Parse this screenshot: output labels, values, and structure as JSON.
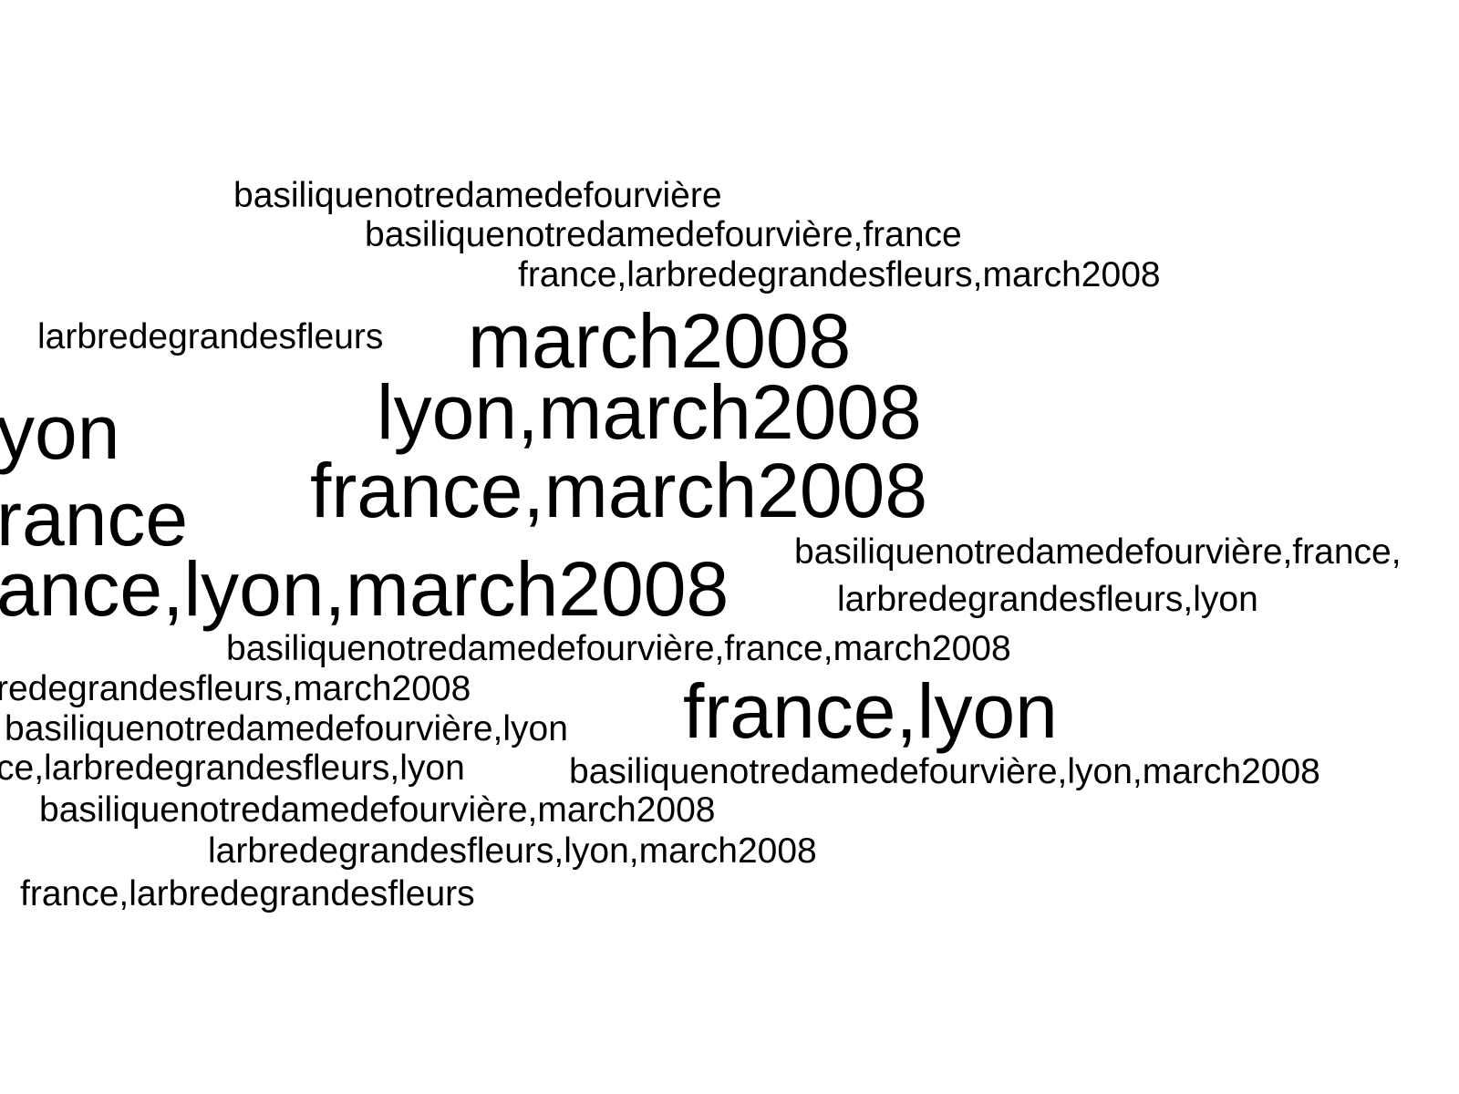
{
  "word_cloud": {
    "text_color": "#000000",
    "background_color": "#ffffff",
    "words": [
      {
        "text": "basiliquenotredamedefourvière",
        "size": "small"
      },
      {
        "text": "basiliquenotredamedefourvière,france",
        "size": "small"
      },
      {
        "text": "france,larbredegrandesfleurs,march2008",
        "size": "small"
      },
      {
        "text": "larbredegrandesfleurs",
        "size": "small"
      },
      {
        "text": "march2008",
        "size": "large"
      },
      {
        "text": "lyon,march2008",
        "size": "large"
      },
      {
        "text": "yon",
        "size": "large"
      },
      {
        "text": "france,march2008",
        "size": "large"
      },
      {
        "text": "rance",
        "size": "large"
      },
      {
        "text": "basiliquenotredamedefourvière,france,",
        "size": "small"
      },
      {
        "text": "ance,lyon,march2008",
        "size": "large"
      },
      {
        "text": "larbredegrandesfleurs,lyon",
        "size": "small"
      },
      {
        "text": "basiliquenotredamedefourvière,france,march2008",
        "size": "small"
      },
      {
        "text": "redegrandesfleurs,march2008",
        "size": "small"
      },
      {
        "text": "france,lyon",
        "size": "large"
      },
      {
        "text": "basiliquenotredamedefourvière,lyon",
        "size": "small"
      },
      {
        "text": "ce,larbredegrandesfleurs,lyon",
        "size": "small"
      },
      {
        "text": "basiliquenotredamedefourvière,lyon,march2008",
        "size": "small"
      },
      {
        "text": "basiliquenotredamedefourvière,march2008",
        "size": "small"
      },
      {
        "text": "larbredegrandesfleurs,lyon,march2008",
        "size": "small"
      },
      {
        "text": "france,larbredegrandesfleurs",
        "size": "small"
      }
    ]
  }
}
